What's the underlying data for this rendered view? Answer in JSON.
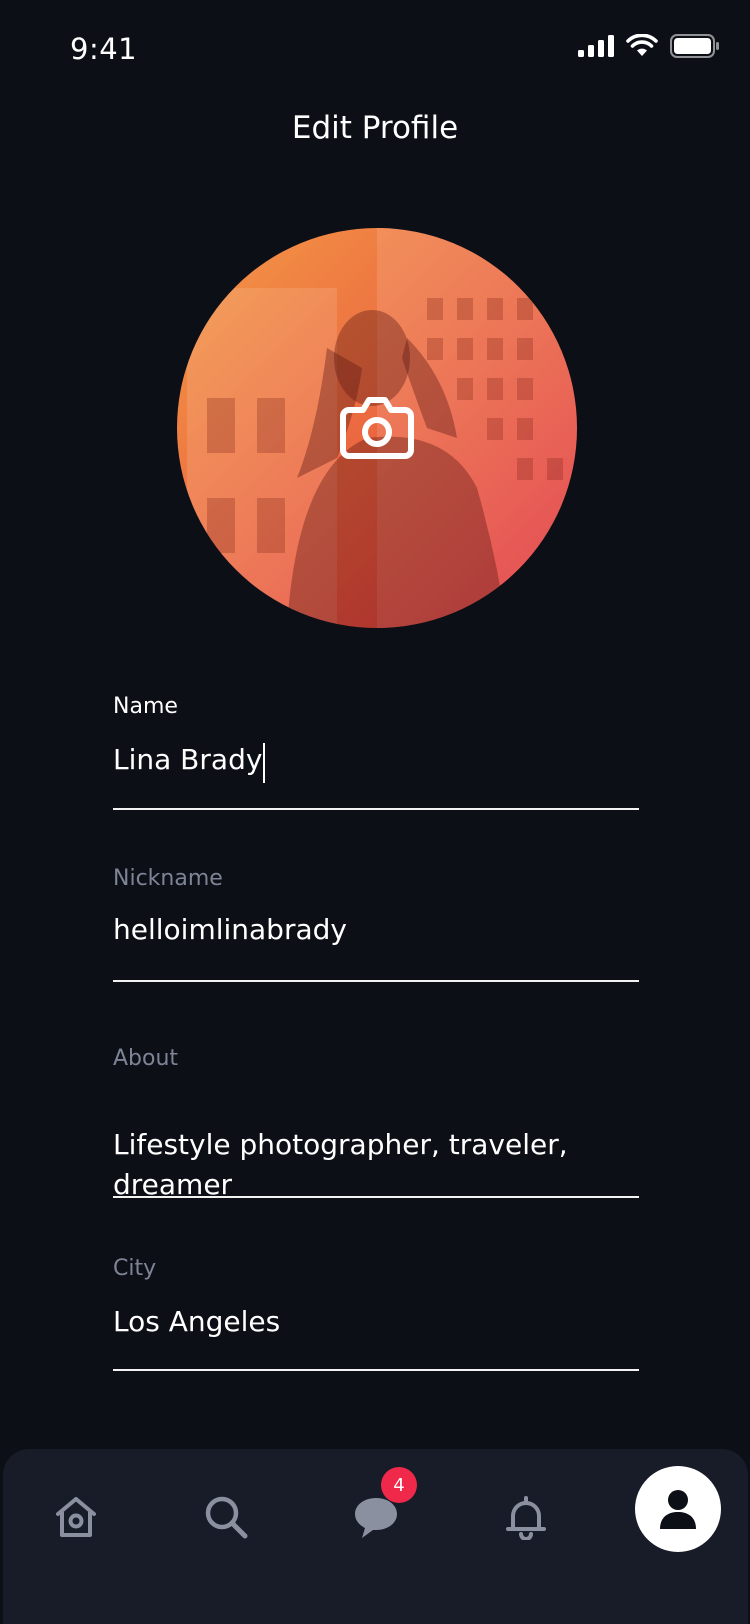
{
  "status": {
    "time": "9:41"
  },
  "header": {
    "title": "Edit Profile"
  },
  "avatar": {
    "action_icon": "camera-icon",
    "gradient": [
      "#f28a3c",
      "#e0303f"
    ]
  },
  "fields": {
    "name": {
      "label": "Name",
      "value": "Lina Brady"
    },
    "nickname": {
      "label": "Nickname",
      "value": "helloimlinabrady"
    },
    "about": {
      "label": "About",
      "value_line1": "Lifestyle photographer, traveler,",
      "value_line2": "dreamer"
    },
    "city": {
      "label": "City",
      "value": "Los Angeles"
    }
  },
  "tabbar": {
    "items": [
      {
        "icon": "home-icon"
      },
      {
        "icon": "search-icon"
      },
      {
        "icon": "chat-icon",
        "badge": "4"
      },
      {
        "icon": "bell-icon"
      },
      {
        "icon": "profile-icon",
        "active": true
      }
    ]
  },
  "colors": {
    "background": "#0d0f17",
    "tabbar": "#181b28",
    "accent": "#f0294a",
    "muted": "#7d8496"
  }
}
